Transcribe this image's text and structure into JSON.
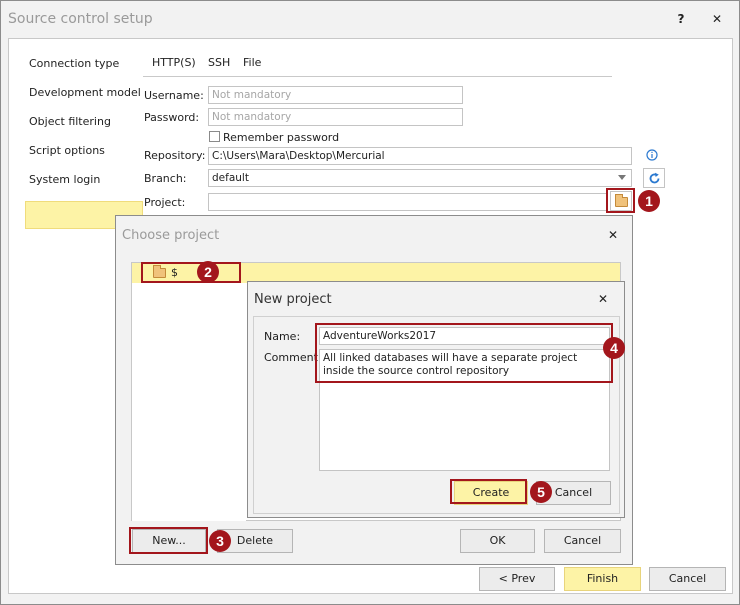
{
  "window": {
    "title": "Source control setup",
    "help_label": "?",
    "close_label": "✕"
  },
  "nav": {
    "items": [
      "Connection type",
      "Development model",
      "Object filtering",
      "Script options",
      "System login"
    ],
    "active": "System login"
  },
  "tabs": [
    "HTTP(S)",
    "SSH",
    "File"
  ],
  "form": {
    "username_label": "Username:",
    "username_placeholder": "Not mandatory",
    "password_label": "Password:",
    "password_placeholder": "Not mandatory",
    "remember_label": "Remember password",
    "repository_label": "Repository:",
    "repository_value": "C:\\Users\\Mara\\Desktop\\Mercurial",
    "branch_label": "Branch:",
    "branch_value": "default",
    "project_label": "Project:",
    "project_value": ""
  },
  "choose_dialog": {
    "title": "Choose project",
    "close_label": "✕",
    "root_item": "$",
    "new_label": "New...",
    "delete_label": "Delete",
    "ok_label": "OK",
    "cancel_label": "Cancel"
  },
  "new_dialog": {
    "title": "New project",
    "close_label": "✕",
    "name_label": "Name:",
    "name_value": "AdventureWorks2017",
    "comment_label": "Comment:",
    "comment_value": "All linked databases will have a separate project inside the source control repository",
    "create_label": "Create",
    "cancel_label": "Cancel"
  },
  "footer": {
    "prev_label": "< Prev",
    "finish_label": "Finish",
    "cancel_label": "Cancel"
  },
  "callouts": [
    "1",
    "2",
    "3",
    "4",
    "5"
  ],
  "colors": {
    "accent_yellow": "#fdf3a6",
    "callout_red": "#a3161c",
    "info_blue": "#2b79d0"
  },
  "icons": {
    "info": "info-icon",
    "refresh": "refresh-icon",
    "folder": "folder-icon",
    "dropdown": "chevron-down-icon"
  }
}
